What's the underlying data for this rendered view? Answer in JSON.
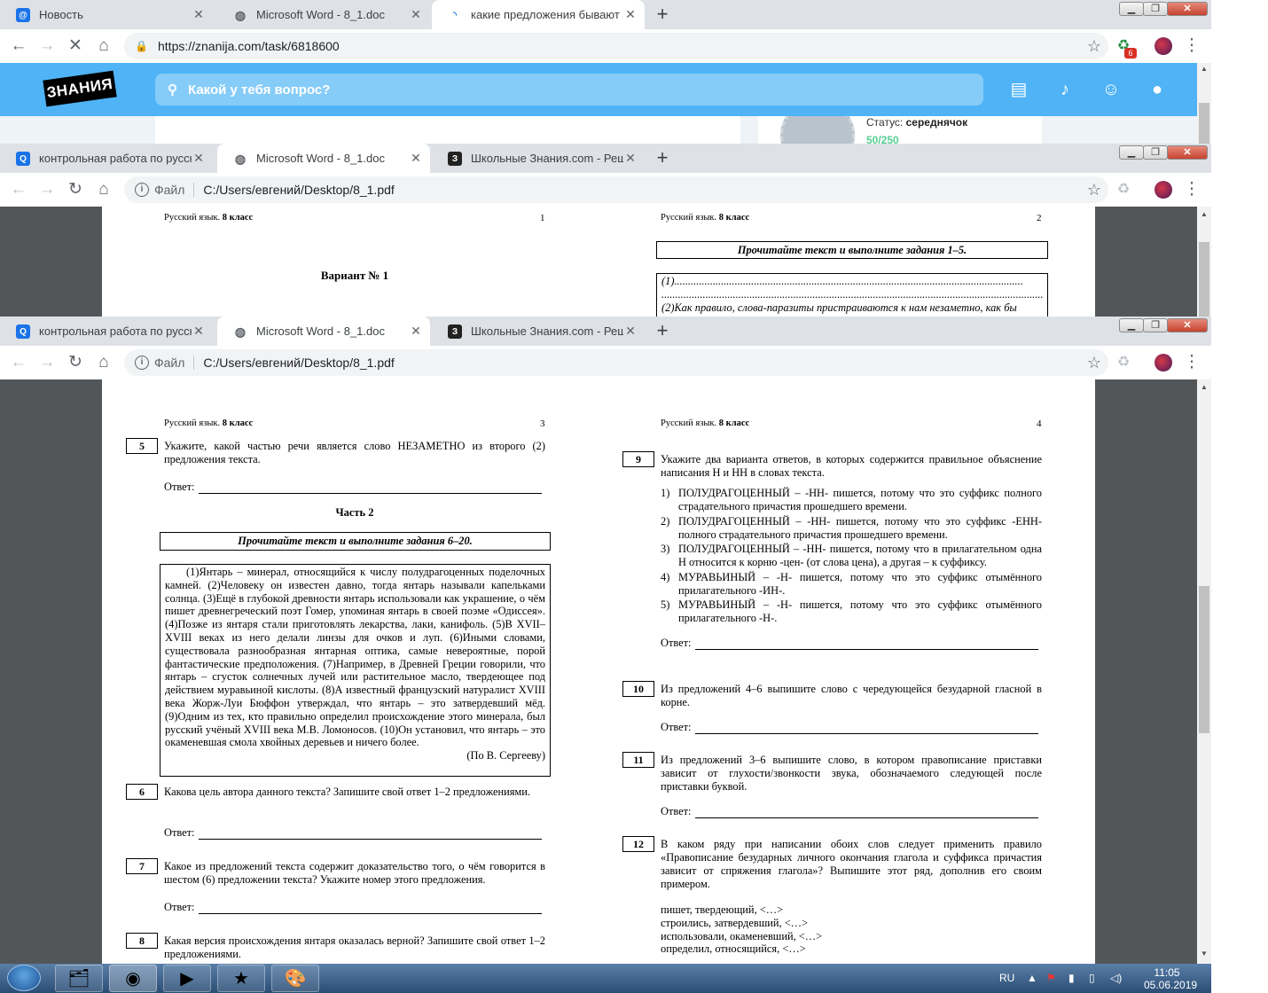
{
  "window1": {
    "tabs": [
      {
        "label": "Новость",
        "icon": "mail-ru-icon",
        "color": "#1a73e8"
      },
      {
        "label": "Microsoft Word - 8_1.doc",
        "icon": "globe-icon"
      },
      {
        "label": "какие предложения бывают по",
        "icon": "loading-icon"
      }
    ],
    "url": "https://znanija.com/task/6818600",
    "notification_count": "6"
  },
  "znanija": {
    "logo": "ЗНАНИЯ",
    "search_placeholder": "Какой у тебя вопрос?",
    "status_label": "Статус:",
    "status_value": "середнячок",
    "points": "50/250",
    "brand_color": "#4fb3f6"
  },
  "window2": {
    "tabs": [
      {
        "label": "контрольная работа по русском",
        "icon": "search-icon"
      },
      {
        "label": "Microsoft Word - 8_1.doc",
        "icon": "globe-icon"
      },
      {
        "label": "Школьные Знания.com - Решае",
        "icon": "znanija-icon"
      }
    ],
    "file_label": "Файл",
    "path": "C:/Users/евгений/Desktop/8_1.pdf"
  },
  "window3": {
    "tabs": [
      {
        "label": "контрольная работа по русском",
        "icon": "search-icon"
      },
      {
        "label": "Microsoft Word - 8_1.doc",
        "icon": "globe-icon"
      },
      {
        "label": "Школьные Знания.com - Решае",
        "icon": "znanija-icon"
      }
    ],
    "file_label": "Файл",
    "path": "C:/Users/евгений/Desktop/8_1.pdf"
  },
  "doc": {
    "header_subject": "Русский язык.",
    "header_grade": "8 класс",
    "answer_label": "Ответ:",
    "page1": {
      "num": "1",
      "title": "Вариант № 1"
    },
    "page2": {
      "num": "2",
      "instruction": "Прочитайте текст и выполните задания 1–5.",
      "line1": "(1)...............................................................................................................................",
      "line2": "(2)Как правило, слова-паразиты пристраиваются к нам незаметно, как бы"
    },
    "page3": {
      "num": "3",
      "q5_num": "5",
      "q5_text": "Укажите, какой частью речи является слово НЕЗАМЕТНО из второго (2) предложения текста.",
      "part2": "Часть 2",
      "instruction": "Прочитайте текст и выполните задания 6–20.",
      "passage": "(1)Янтарь – минерал, относящийся к числу полудрагоценных поделочных камней. (2)Человеку он известен давно, тогда янтарь называли капельками солнца. (3)Ещё в глубокой древности янтарь использовали как украшение, о чём пишет древнегреческий поэт Гомер, упоминая янтарь в своей поэме «Одиссея». (4)Позже из янтаря стали приготовлять лекарства, лаки, канифоль. (5)В XVII–XVIII веках из него делали линзы для очков и луп. (6)Иными словами, существовала разнообразная янтарная оптика, самые невероятные, порой фантастические предположения. (7)Например, в Древней Греции говорили, что янтарь – сгусток солнечных лучей или растительное масло, твердеющее под действием муравьиной кислоты. (8)А известный французский натуралист XVIII века Жорж-Луи Бюффон утверждал, что янтарь – это затвердевший мёд. (9)Одним из тех, кто правильно определил происхождение этого минерала, был русский учёный XVIII века М.В. Ломоносов. (10)Он установил, что янтарь – это окаменевшая смола хвойных деревьев и ничего более.",
      "passage_author": "(По В. Сергееву)",
      "q6_num": "6",
      "q6_text": "Какова цель автора данного текста? Запишите свой ответ 1–2 предложениями.",
      "q7_num": "7",
      "q7_text": "Какое из предложений текста содержит доказательство того, о чём говорится в шестом (6) предложении текста? Укажите номер этого предложения.",
      "q8_num": "8",
      "q8_text": "Какая версия происхождения янтаря оказалась верной? Запишите свой ответ 1–2 предложениями."
    },
    "page4": {
      "num": "4",
      "q9_num": "9",
      "q9_text": "Укажите два варианта ответов, в которых содержится правильное объяснение написания Н и НН в словах текста.",
      "q9_options": [
        {
          "n": "1)",
          "text": "ПОЛУДРАГОЦЕННЫЙ – -НН- пишется, потому что это суффикс полного страдательного причастия прошедшего времени."
        },
        {
          "n": "2)",
          "text": "ПОЛУДРАГОЦЕННЫЙ – -НН- пишется, потому что это суффикс -ЕНН- полного страдательного причастия прошедшего времени."
        },
        {
          "n": "3)",
          "text": "ПОЛУДРАГОЦЕННЫЙ – -НН- пишется, потому что в прилагательном одна Н относится к корню -цен- (от слова цена), а другая – к суффиксу."
        },
        {
          "n": "4)",
          "text": "МУРАВЬИНЫЙ – -Н- пишется, потому что это суффикс отымённого прилагательного -ИН-."
        },
        {
          "n": "5)",
          "text": "МУРАВЬИНЫЙ – -Н- пишется, потому что это суффикс отымённого прилагательного -Н-."
        }
      ],
      "q10_num": "10",
      "q10_text": "Из предложений 4–6 выпишите слово с чередующейся безударной гласной в корне.",
      "q11_num": "11",
      "q11_text": "Из предложений 3–6 выпишите слово, в котором правописание приставки зависит от глухости/звонкости звука, обозначаемого следующей после приставки буквой.",
      "q12_num": "12",
      "q12_text": "В каком ряду при написании обоих слов следует применить правило «Правописание безударных личного окончания глагола и суффикса причастия зависит от спряжения глагола»? Выпишите этот ряд, дополнив его своим примером.",
      "q12_rows": [
        "пишет, твердеющий, <…>",
        "строились, затвердевший, <…>",
        "использовали, окаменевший, <…>",
        "определил, относящийся, <…>"
      ]
    }
  },
  "taskbar": {
    "lang": "RU",
    "time": "11:05",
    "date": "05.06.2019"
  }
}
